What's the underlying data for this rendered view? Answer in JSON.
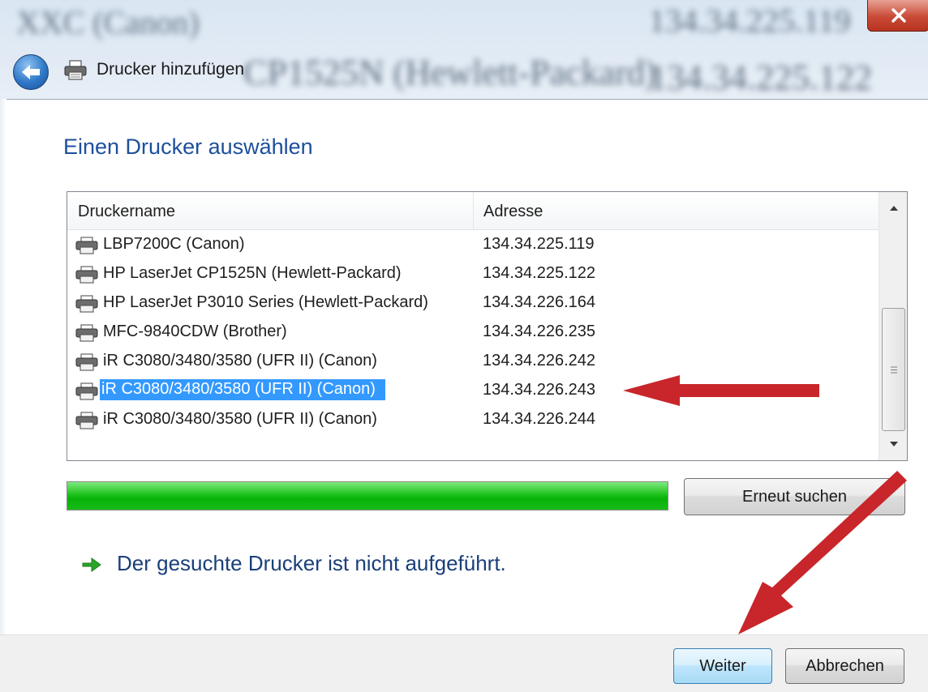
{
  "window": {
    "title": "Drucker hinzufügen",
    "background_blur_texts": [
      "XXC (Canon)",
      "134.34.225.119",
      "CP1525N (Hewlett-Packard)",
      "134.34.225.122"
    ]
  },
  "main": {
    "heading": "Einen Drucker auswählen",
    "list": {
      "columns": [
        "Druckername",
        "Adresse"
      ],
      "rows": [
        {
          "name": "LBP7200C (Canon)",
          "address": "134.34.225.119",
          "selected": false
        },
        {
          "name": "HP LaserJet CP1525N (Hewlett-Packard)",
          "address": "134.34.225.122",
          "selected": false
        },
        {
          "name": "HP LaserJet P3010 Series (Hewlett-Packard)",
          "address": "134.34.226.164",
          "selected": false
        },
        {
          "name": "MFC-9840CDW (Brother)",
          "address": "134.34.226.235",
          "selected": false
        },
        {
          "name": "iR C3080/3480/3580 (UFR II) (Canon)",
          "address": "134.34.226.242",
          "selected": false
        },
        {
          "name": "iR C3080/3480/3580 (UFR II) (Canon)",
          "address": "134.34.226.243",
          "selected": true
        },
        {
          "name": "iR C3080/3480/3580 (UFR II) (Canon)",
          "address": "134.34.226.244",
          "selected": false
        }
      ]
    },
    "search_progress": 1.0,
    "research_label": "Erneut suchen",
    "not_listed_link": "Der gesuchte Drucker ist nicht aufgeführt."
  },
  "footer": {
    "next_label": "Weiter",
    "cancel_label": "Abbrechen"
  },
  "icons": {
    "back": "back-arrow-icon",
    "printer": "printer-icon",
    "close": "close-icon",
    "link_arrow": "green-arrow-icon"
  },
  "colors": {
    "heading": "#1d4f9c",
    "selection": "#3399ff",
    "progress": "#07b207",
    "annotation_arrow": "#c8262b"
  }
}
